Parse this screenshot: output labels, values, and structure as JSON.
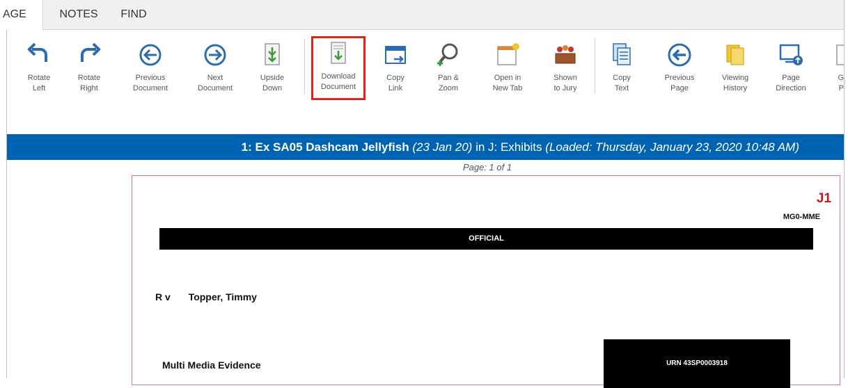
{
  "tabs": [
    {
      "label": "AGE"
    },
    {
      "label": "NOTES"
    },
    {
      "label": "FIND"
    }
  ],
  "ribbon": {
    "buttons": [
      {
        "label": "Rotate\nLeft",
        "icon": "rotate-left-icon"
      },
      {
        "label": "Rotate\nRight",
        "icon": "rotate-right-icon"
      },
      {
        "label": "Previous\nDocument",
        "icon": "previous-document-icon"
      },
      {
        "label": "Next\nDocument",
        "icon": "next-document-icon"
      },
      {
        "label": "Upside\nDown",
        "icon": "upside-down-icon"
      },
      {
        "label": "Download\nDocument",
        "icon": "download-document-icon"
      },
      {
        "label": "Copy\nLink",
        "icon": "copy-link-icon"
      },
      {
        "label": "Pan &\nZoom",
        "icon": "pan-zoom-icon"
      },
      {
        "label": "Open in\nNew Tab",
        "icon": "open-new-tab-icon"
      },
      {
        "label": "Shown\nto Jury",
        "icon": "shown-to-jury-icon"
      },
      {
        "label": "Copy\nText",
        "icon": "copy-text-icon"
      },
      {
        "label": "Previous\nPage",
        "icon": "previous-page-icon"
      },
      {
        "label": "Viewing\nHistory",
        "icon": "viewing-history-icon"
      },
      {
        "label": "Page\nDirection",
        "icon": "page-direction-icon"
      },
      {
        "label": "G\nP",
        "icon": "partial-icon"
      }
    ],
    "highlighted": "Download Document",
    "highlight_color": "#e2231a"
  },
  "doc_header": {
    "number_title": "1: Ex SA05 Dashcam Jellyfish",
    "date": "(23 Jan 20)",
    "location": " in J: Exhibits ",
    "loaded": "(Loaded: Thursday, January 23, 2020 10:48 AM)",
    "background": "#0063b1"
  },
  "page_label": "Page: 1 of 1",
  "document": {
    "exhibit_ref": "J1",
    "form_code": "MG0-MME",
    "banner": "OFFICIAL",
    "case_prefix": "R v",
    "defendant": "Topper, Timmy",
    "heading": "Multi Media Evidence",
    "urn": "URN 43SP0003918"
  }
}
